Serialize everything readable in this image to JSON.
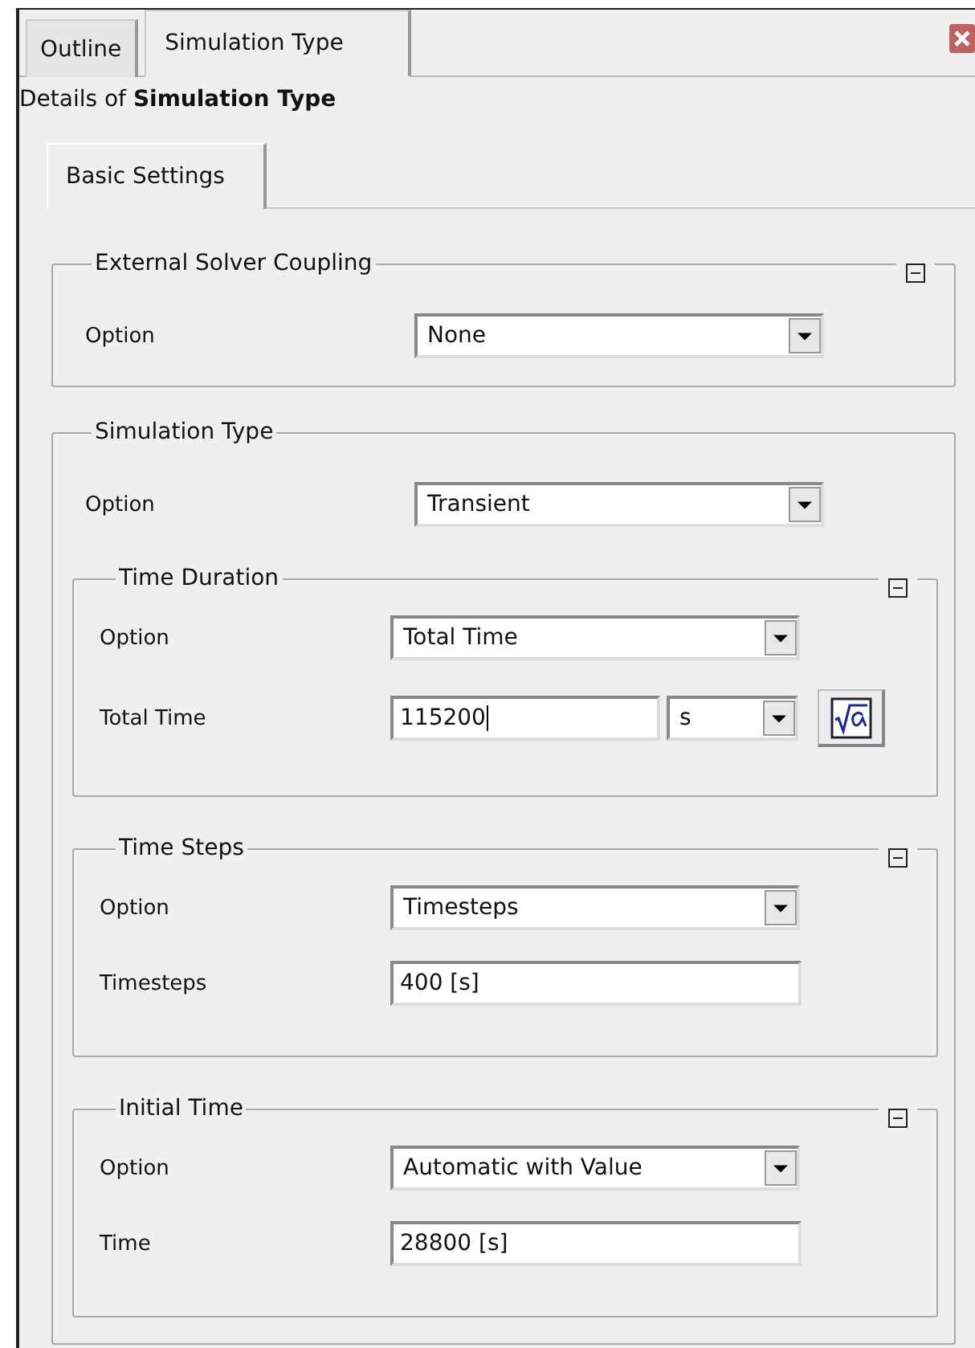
{
  "tabs": [
    {
      "label": "Outline",
      "selected": false
    },
    {
      "label": "Simulation Type",
      "selected": true
    }
  ],
  "heading": "Details of **Simulation Type**",
  "subtabs": [
    {
      "label": "Basic Settings",
      "selected": true
    }
  ],
  "groups": [
    {
      "title": "External Solver Coupling",
      "collapsible": true,
      "rows": [
        {
          "kind": "dropdown",
          "label": "Option",
          "value": "None"
        }
      ]
    },
    {
      "title": "Simulation Type",
      "collapsible": false,
      "rows": [
        {
          "kind": "dropdown",
          "label": "Option",
          "value": "Transient"
        }
      ],
      "groups": [
        {
          "title": "Time Duration",
          "collapsible": true,
          "rows": [
            {
              "kind": "dropdown",
              "label": "Option",
              "value": "Total Time"
            },
            {
              "kind": "unit",
              "label": "Total Time",
              "value": "115200",
              "unit": "s"
            }
          ]
        },
        {
          "title": "Time Steps",
          "collapsible": true,
          "rows": [
            {
              "kind": "dropdown",
              "label": "Option",
              "value": "Timesteps"
            },
            {
              "kind": "text",
              "label": "Timesteps",
              "value": "400 [s]"
            }
          ]
        },
        {
          "title": "Initial Time",
          "collapsible": true,
          "rows": [
            {
              "kind": "dropdown",
              "label": "Option",
              "value": "Automatic with Value"
            },
            {
              "kind": "text",
              "label": "Time",
              "value": "28800 [s]"
            }
          ]
        }
      ]
    }
  ]
}
